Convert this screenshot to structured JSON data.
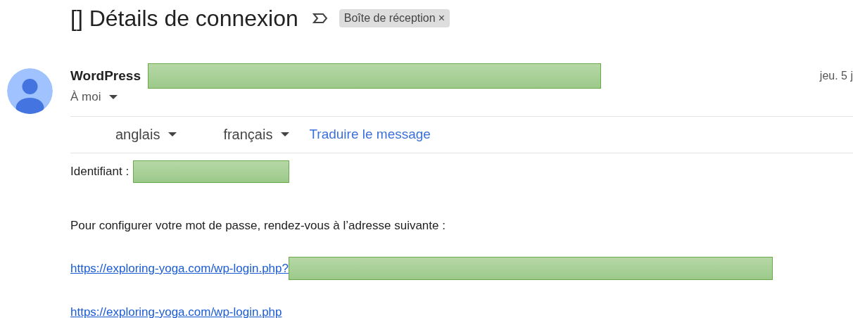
{
  "subject": "[] Détails de connexion",
  "label": {
    "text": "Boîte de réception",
    "close": "×"
  },
  "sender": {
    "name": "WordPress",
    "recipient": "À moi",
    "date": "jeu. 5 j"
  },
  "translate": {
    "source": "anglais",
    "target": "français",
    "action": "Traduire le message"
  },
  "body": {
    "login_label": "Identifiant :",
    "instruction": "Pour configurer votre mot de passe, rendez-vous à l’adresse suivante :",
    "reset_link": "https://exploring-yoga.com/wp-login.php?",
    "login_link": "https://exploring-yoga.com/wp-login.php"
  }
}
